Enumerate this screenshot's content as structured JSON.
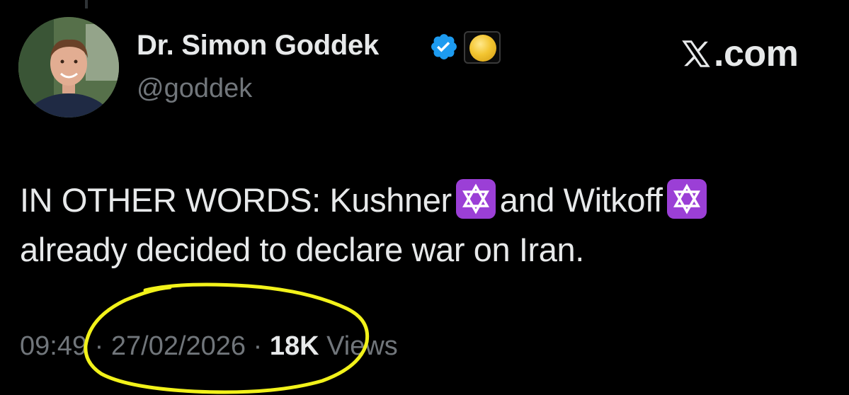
{
  "author": {
    "display_name": "Dr. Simon Goddek",
    "handle": "@goddek",
    "verified_icon": "verified-check-icon",
    "badge_icon": "gold-coin-badge-icon",
    "avatar_icon": "profile-photo"
  },
  "brand": {
    "logo_icon": "x-logo-icon",
    "logo_text": ".com"
  },
  "post": {
    "line1_part1": "IN OTHER WORDS: Kushner",
    "line1_part2": "and Witkoff",
    "line2": "already decided to declare war on Iran.",
    "emoji_icon": "star-of-david-icon"
  },
  "meta": {
    "time": "09:49",
    "separator": "·",
    "date": "27/02/2026",
    "views_count": "18K",
    "views_label": "Views"
  },
  "colors": {
    "background": "#000000",
    "primary_text": "#e7e9ea",
    "secondary_text": "#71767b",
    "verified_blue": "#1d9bf0",
    "emoji_purple": "#9b3fd6",
    "annotation_yellow": "#f2f21a"
  }
}
